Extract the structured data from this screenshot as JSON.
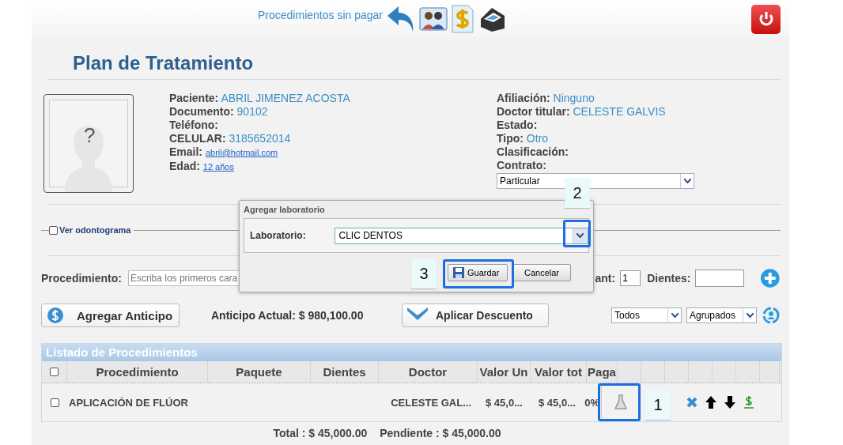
{
  "header": {
    "link": "Procedimientos sin pagar"
  },
  "title": "Plan de Tratamiento",
  "patient": {
    "left": [
      {
        "label": "Paciente:",
        "value": "ABRIL JIMENEZ ACOSTA",
        "kind": "text"
      },
      {
        "label": "Documento:",
        "value": "90102",
        "kind": "text"
      },
      {
        "label": "Teléfono:",
        "kind": "text"
      },
      {
        "label": "CELULAR:",
        "value": "3185652014",
        "kind": "text"
      },
      {
        "label": "Email:",
        "value": "abril@hotmail.com",
        "kind": "link"
      },
      {
        "label": "Edad:",
        "value": "12 años",
        "kind": "link"
      }
    ],
    "right": [
      {
        "label": "Afiliación:",
        "value": "Ninguno",
        "kind": "text"
      },
      {
        "label": "Doctor titular:",
        "value": "CELESTE GALVIS",
        "kind": "text"
      },
      {
        "label": "Estado:",
        "kind": "text"
      },
      {
        "label": "Tipo:",
        "value": "Otro",
        "kind": "text"
      },
      {
        "label": "Clasificación:",
        "kind": "text"
      },
      {
        "label": "Contrato:",
        "kind": "text"
      }
    ],
    "contract": "Particular",
    "avatar_mark": "?"
  },
  "odontogram": {
    "label": "Ver odontograma",
    "checked": false
  },
  "procedure_form": {
    "label": "Procedimiento:",
    "placeholder": "Escriba los primeros cara",
    "cant_label": "ant:",
    "cant_value": "1",
    "teeth_label": "Dientes:"
  },
  "advance_button": "Agregar Anticipo",
  "advance_current": "Anticipo Actual: $ 980,100.00",
  "discount_button": "Aplicar Descuento",
  "filters": [
    "Todos",
    "Agrupados"
  ],
  "table": {
    "title": "Listado de Procedimientos",
    "all_checked": false,
    "columns": [
      "Procedimiento",
      "Paquete",
      "Dientes",
      "Doctor",
      "Valor Un",
      "Valor tot",
      "Paga"
    ],
    "rows": [
      {
        "checked": false,
        "procedimiento": "APLICACIÓN DE FLÚOR",
        "doctor": "CELESTE GAL...",
        "valor_un": "$ 45,0...",
        "valor_tot": "$ 45,0...",
        "pagado": "0%"
      }
    ]
  },
  "totals": {
    "total": "Total : $ 45,000.00",
    "pending": "Pendiente : $ 45,000.00"
  },
  "modal": {
    "title": "Agregar laboratorio",
    "label": "Laboratorio:",
    "value": "CLIC DENTOS",
    "buttons": [
      "Guardar",
      "Cancelar"
    ]
  },
  "callouts": [
    "1",
    "2",
    "3"
  ]
}
